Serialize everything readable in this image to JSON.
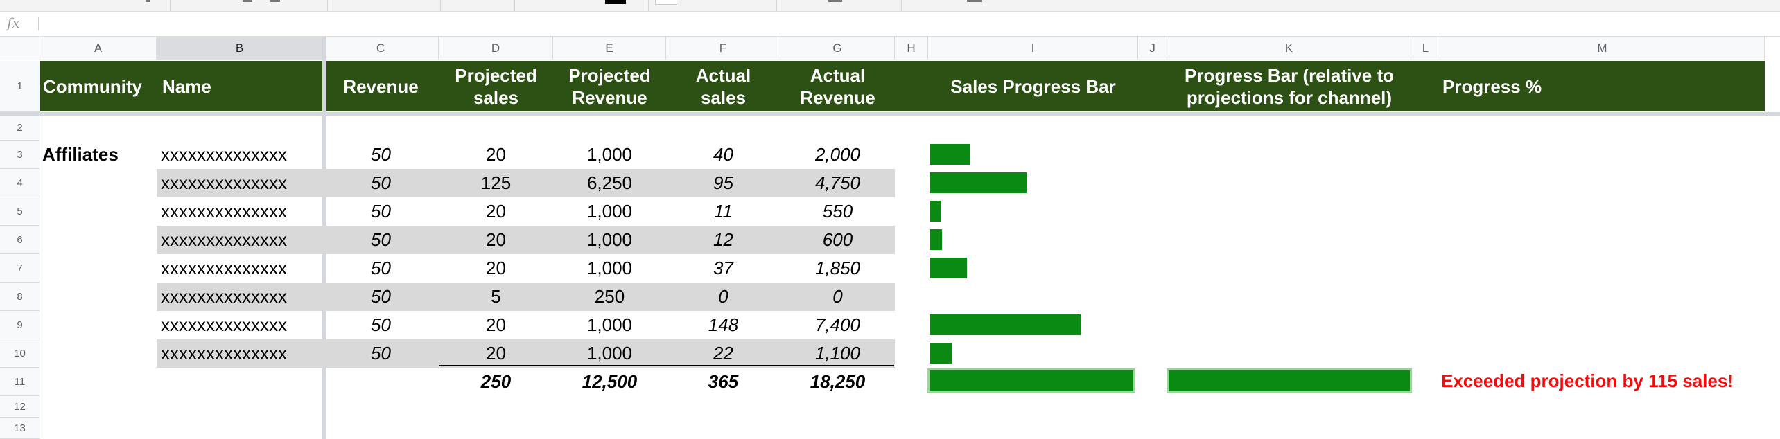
{
  "toolbar": {
    "text_color_swatch": "#000000",
    "fill_color_swatch": "#ffffff"
  },
  "formula_bar": {
    "fx_label": "fx",
    "value": ""
  },
  "columns": [
    "A",
    "B",
    "C",
    "D",
    "E",
    "F",
    "G",
    "H",
    "I",
    "J",
    "K",
    "L",
    "M"
  ],
  "rows": [
    "1",
    "2",
    "3",
    "4",
    "5",
    "6",
    "7",
    "8",
    "9",
    "10",
    "11",
    "12",
    "13"
  ],
  "header": {
    "community": "Community",
    "name": "Name",
    "revenue": "Revenue",
    "projected_sales": "Projected sales",
    "projected_revenue": "Projected Revenue",
    "actual_sales": "Actual sales",
    "actual_revenue": "Actual Revenue",
    "sales_progress_bar": "Sales Progress Bar",
    "progress_bar_relative": "Progress Bar (relative to projections for channel)",
    "progress_pct": "Progress %"
  },
  "community": "Affiliates",
  "data_rows": [
    {
      "name": "xxxxxxxxxxxxxx",
      "revenue": "50",
      "projected_sales": "20",
      "projected_revenue": "1,000",
      "actual_sales": "40",
      "actual_revenue": "2,000",
      "progress": 40
    },
    {
      "name": "xxxxxxxxxxxxxx",
      "revenue": "50",
      "projected_sales": "125",
      "projected_revenue": "6,250",
      "actual_sales": "95",
      "actual_revenue": "4,750",
      "progress": 95
    },
    {
      "name": "xxxxxxxxxxxxxx",
      "revenue": "50",
      "projected_sales": "20",
      "projected_revenue": "1,000",
      "actual_sales": "11",
      "actual_revenue": "550",
      "progress": 11
    },
    {
      "name": "xxxxxxxxxxxxxx",
      "revenue": "50",
      "projected_sales": "20",
      "projected_revenue": "1,000",
      "actual_sales": "12",
      "actual_revenue": "600",
      "progress": 12
    },
    {
      "name": "xxxxxxxxxxxxxx",
      "revenue": "50",
      "projected_sales": "20",
      "projected_revenue": "1,000",
      "actual_sales": "37",
      "actual_revenue": "1,850",
      "progress": 37
    },
    {
      "name": "xxxxxxxxxxxxxx",
      "revenue": "50",
      "projected_sales": "5",
      "projected_revenue": "250",
      "actual_sales": "0",
      "actual_revenue": "0",
      "progress": 0
    },
    {
      "name": "xxxxxxxxxxxxxx",
      "revenue": "50",
      "projected_sales": "20",
      "projected_revenue": "1,000",
      "actual_sales": "148",
      "actual_revenue": "7,400",
      "progress": 148
    },
    {
      "name": "xxxxxxxxxxxxxx",
      "revenue": "50",
      "projected_sales": "20",
      "projected_revenue": "1,000",
      "actual_sales": "22",
      "actual_revenue": "1,100",
      "progress": 22
    }
  ],
  "totals": {
    "projected_sales": "250",
    "projected_revenue": "12,500",
    "actual_sales": "365",
    "actual_revenue": "18,250",
    "sales_progress": 365,
    "relative_progress": 1.0,
    "message": "Exceeded projection by 115 sales!"
  },
  "colors": {
    "header_fill": "#2d5114",
    "bar": "#0a8a12",
    "stripe": "#d9d9d9",
    "message": "#f50b0b"
  }
}
